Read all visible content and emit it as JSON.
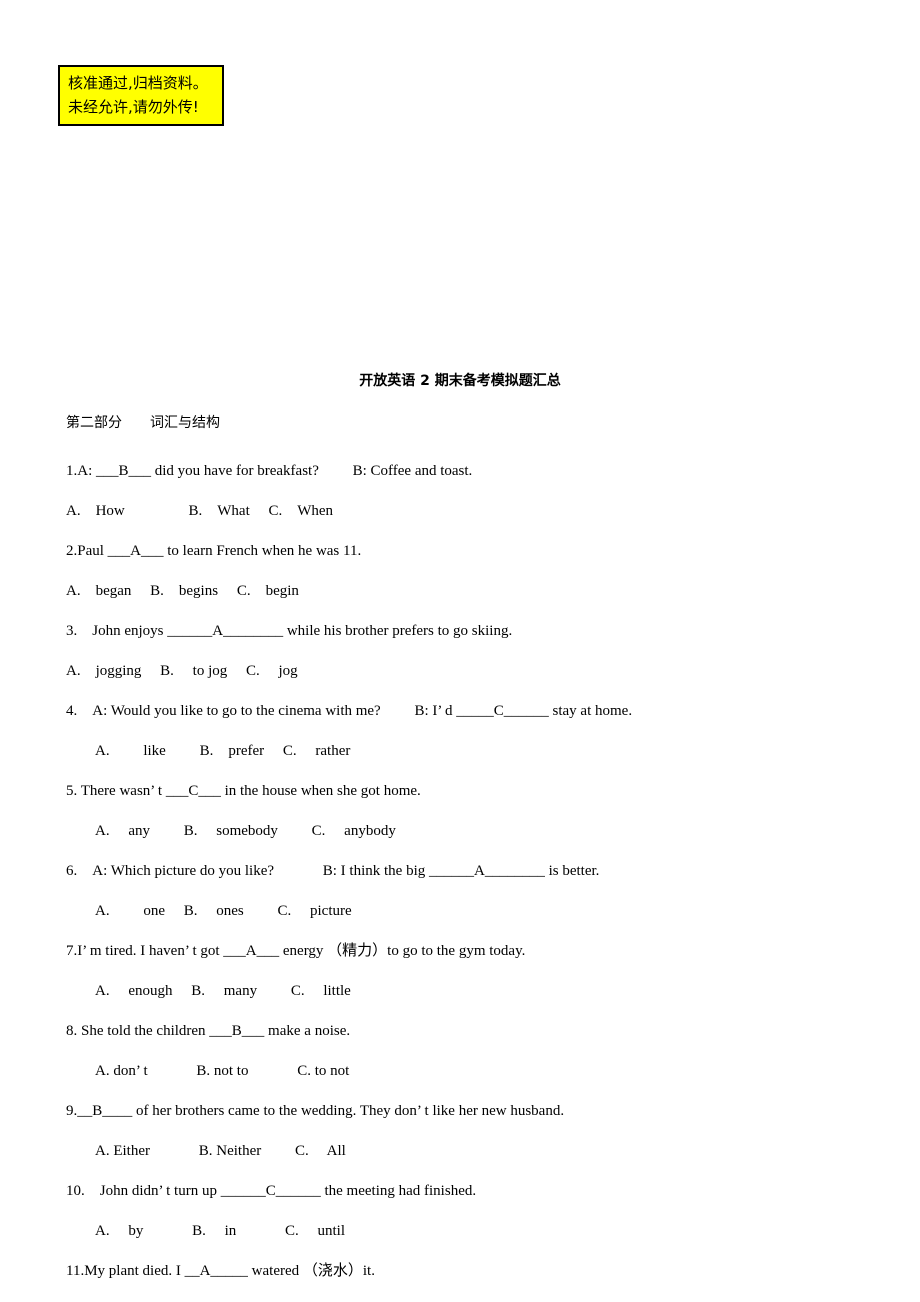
{
  "stamp": {
    "line1": "核准通过,归档资料。",
    "line2": "未经允许,请勿外传!",
    "background_color": "#ffff00",
    "border_color": "#000000"
  },
  "document": {
    "title": "开放英语 2 期末备考模拟题汇总",
    "section_heading": "第二部分　　词汇与结构"
  },
  "questions": [
    {
      "stem": "1.A: ___B___ did you have for breakfast?　　 B: Coffee and toast.",
      "options": "A.　How　　　　 B.　What　 C.　When",
      "options_indent": 0
    },
    {
      "stem": "2.Paul ___A___ to learn French when he was 11.",
      "options": "A.　began　 B.　begins　 C.　begin",
      "options_indent": 0
    },
    {
      "stem": "3.　John enjoys ______A________ while his brother prefers to go skiing.",
      "options": "A.　jogging　 B.　 to jog　 C.　 jog",
      "options_indent": 0
    },
    {
      "stem": "4.　A: Would you like to go to the cinema with me?　　 B: I’ d _____C______ stay at home.",
      "options": "A.　　 like　　 B.　prefer　 C.　 rather",
      "options_indent": 1
    },
    {
      "stem": "5. There wasn’ t ___C___ in the house when she got home.",
      "options": "A.　 any　　 B.　 somebody　　 C.　 anybody",
      "options_indent": 1
    },
    {
      "stem": "6.　A: Which picture do you like?　　　 B: I think the big ______A________ is better.",
      "options": "A.　　 one　 B.　 ones　　 C.　 picture",
      "options_indent": 1
    },
    {
      "stem": "7.I’ m tired. I haven’ t got ___A___ energy （精力）to go to the gym today.",
      "options": "A.　 enough　 B.　 many　　 C.　 little",
      "options_indent": 1
    },
    {
      "stem": "8. She told the children ___B___ make a noise.",
      "options": "A. don’ t　　　 B. not to　　　 C. to not",
      "options_indent": 1
    },
    {
      "stem": "9.__B____ of her brothers came to the wedding. They don’ t like her new husband.",
      "options": "A. Either　　　 B. Neither　　 C.　 All",
      "options_indent": 1
    },
    {
      "stem": "10.　John didn’ t turn up ______C______ the meeting had finished.",
      "options": "A.　 by　　　 B.　 in　　　 C.　 until",
      "options_indent": 1
    },
    {
      "stem": "11.My plant died. I __A_____ watered （浇水）it.",
      "options": "",
      "options_indent": 1
    }
  ]
}
